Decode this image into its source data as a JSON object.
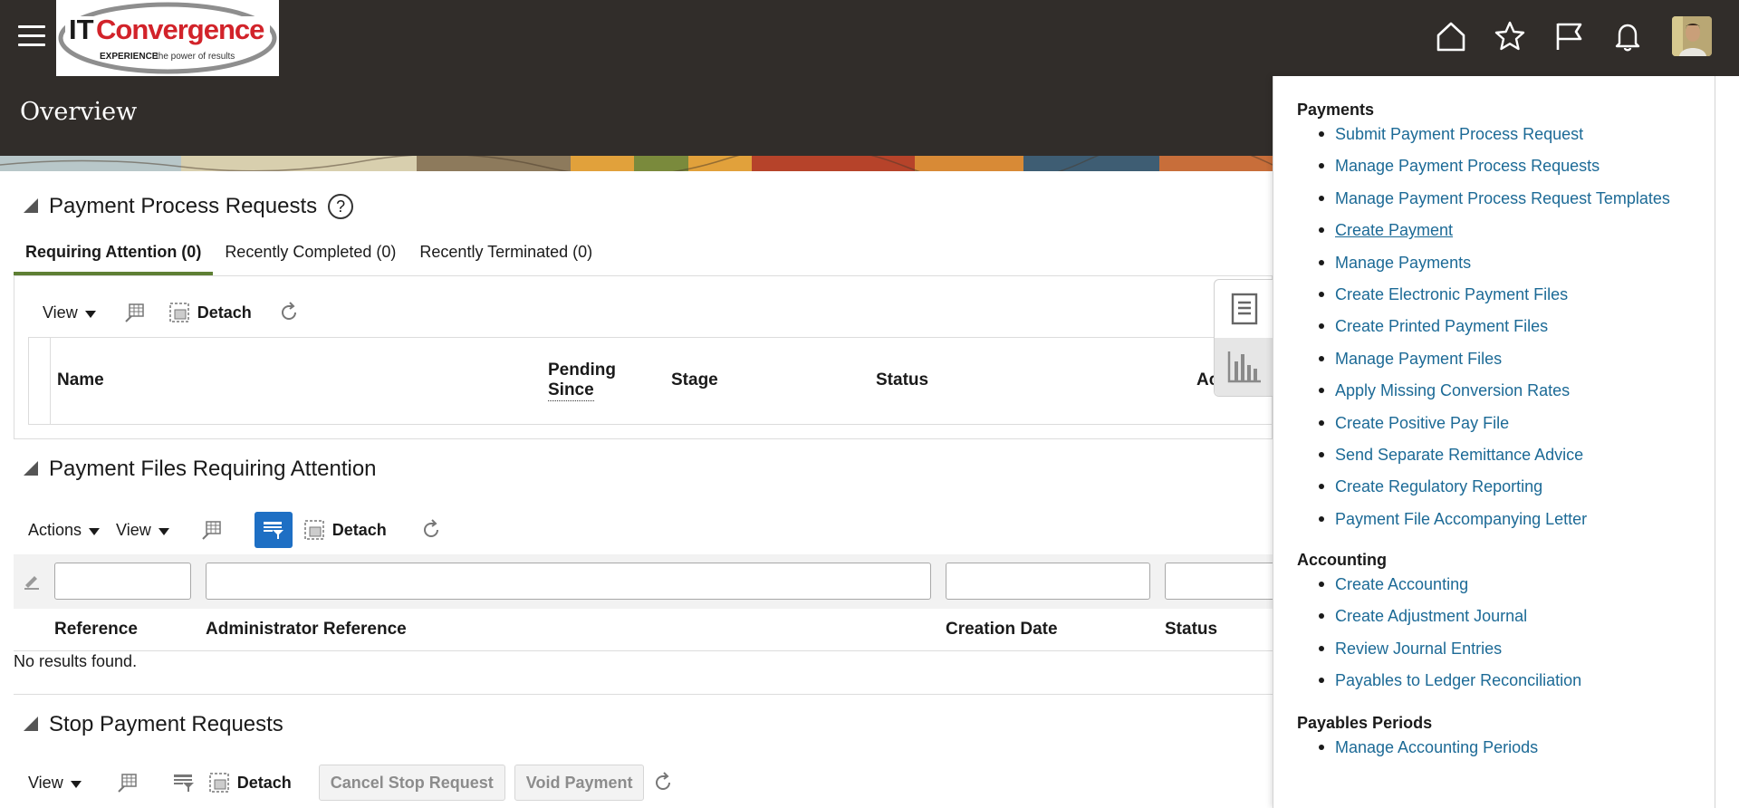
{
  "header": {
    "page_title": "Overview",
    "logo": {
      "brand_it": "IT",
      "brand_name": "Convergence",
      "tagline_strong": "EXPERIENCE",
      "tagline_rest": " the power of results"
    },
    "icons": [
      "home-icon",
      "favorites-star-icon",
      "watchlist-flag-icon",
      "notifications-bell-icon"
    ]
  },
  "payment_process_requests": {
    "title": "Payment Process Requests",
    "help_glyph": "?",
    "tabs": [
      {
        "label": "Requiring Attention (0)",
        "active": true
      },
      {
        "label": "Recently Completed (0)",
        "active": false
      },
      {
        "label": "Recently Terminated (0)",
        "active": false
      }
    ],
    "toolbar": {
      "view": "View",
      "detach": "Detach"
    },
    "columns": {
      "name": "Name",
      "pending_since_1": "Pending",
      "pending_since_2": "Since",
      "stage": "Stage",
      "status": "Status",
      "actions": "Ac"
    }
  },
  "payment_files": {
    "title": "Payment Files Requiring Attention",
    "toolbar": {
      "actions": "Actions",
      "view": "View",
      "detach": "Detach"
    },
    "columns": {
      "reference": "Reference",
      "admin_reference": "Administrator Reference",
      "creation_date": "Creation Date",
      "status": "Status"
    },
    "empty_message": "No results found."
  },
  "stop_payment_requests": {
    "title": "Stop Payment Requests",
    "toolbar": {
      "view": "View",
      "detach": "Detach",
      "cancel_stop": "Cancel Stop Request",
      "void_payment": "Void Payment"
    }
  },
  "tasks": {
    "groups": [
      {
        "title": "Payments",
        "items": [
          "Submit Payment Process Request",
          "Manage Payment Process Requests",
          "Manage Payment Process Request Templates",
          "Create Payment",
          "Manage Payments",
          "Create Electronic Payment Files",
          "Create Printed Payment Files",
          "Manage Payment Files",
          "Apply Missing Conversion Rates",
          "Create Positive Pay File",
          "Send Separate Remittance Advice",
          "Create Regulatory Reporting",
          "Payment File Accompanying Letter"
        ]
      },
      {
        "title": "Accounting",
        "items": [
          "Create Accounting",
          "Create Adjustment Journal",
          "Review Journal Entries",
          "Payables to Ledger Reconciliation"
        ]
      },
      {
        "title": "Payables Periods",
        "items": [
          "Manage Accounting Periods"
        ]
      }
    ],
    "hovered_item": "Create Payment"
  },
  "colors": {
    "header_bg": "#312d2a",
    "link": "#1c6a96",
    "active_tab": "#5e7f34",
    "logo_red": "#d2232a",
    "primary_button": "#1e6fc4"
  }
}
